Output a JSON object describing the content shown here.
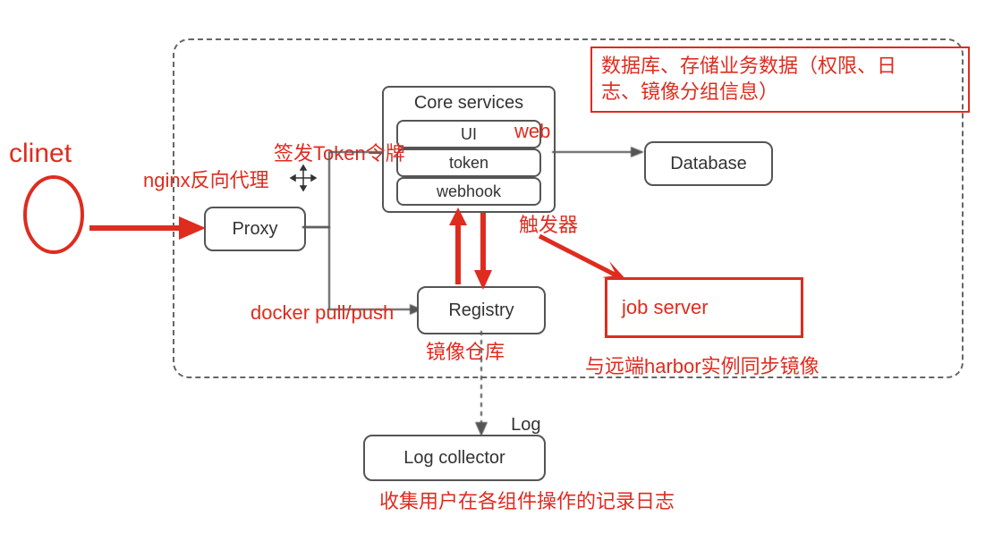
{
  "nodes": {
    "client_label": "clinet",
    "proxy": "Proxy",
    "core_services_title": "Core services",
    "core_ui": "UI",
    "core_token": "token",
    "core_webhook": "webhook",
    "database": "Database",
    "registry": "Registry",
    "log_label": "Log",
    "log_collector": "Log collector",
    "job_server": "job server"
  },
  "annotations": {
    "nginx_proxy": "nginx反向代理",
    "token_label": "签发Token令牌",
    "web_label": "web",
    "database_note": "数据库、存储业务数据（权限、日\n志、镜像分组信息）",
    "docker_pull_push": "docker pull/push",
    "registry_label": "镜像仓库",
    "trigger_label": "触发器",
    "job_server_note": "与远端harbor实例同步镜像",
    "log_collector_note": "收集用户在各组件操作的记录日志"
  }
}
